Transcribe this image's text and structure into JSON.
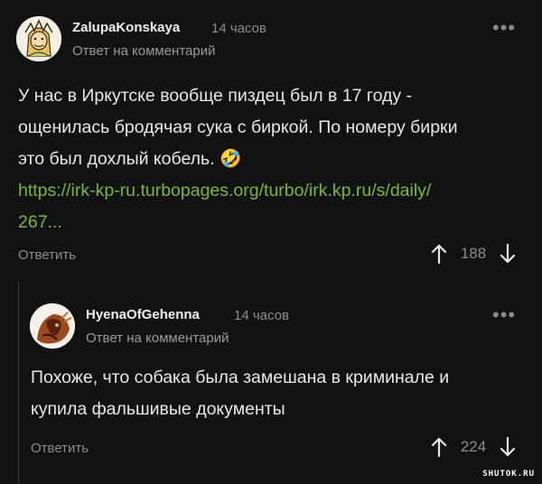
{
  "comments": [
    {
      "username": "ZalupaKonskaya",
      "time": "14 часов",
      "reply_to": "Ответ на комментарий",
      "text_lines": [
        "У нас в Иркутске вообще пиздец был в 17 году -",
        "ощенилась бродячая сука с биркой. По номеру бирки",
        "это был дохлый кобель. 🤣"
      ],
      "link_lines": [
        "https://irk-kp-ru.turbopages.org/turbo/irk.kp.ru/s/daily/",
        "267..."
      ],
      "reply_label": "Ответить",
      "score": "188"
    },
    {
      "username": "HyenaOfGehenna",
      "time": "14 часов",
      "reply_to": "Ответ на комментарий",
      "text_lines": [
        "Похоже, что собака была замешана в криминале и",
        "купила фальшивые документы"
      ],
      "reply_label": "Ответить",
      "score": "224"
    }
  ],
  "icons": {
    "more": "more-dots-icon",
    "upvote": "arrow-up-icon",
    "downvote": "arrow-down-icon"
  },
  "colors": {
    "background": "#121212",
    "link": "#7cb82f",
    "muted": "#8c8c8c"
  },
  "watermark": "SHUTOK.RU"
}
